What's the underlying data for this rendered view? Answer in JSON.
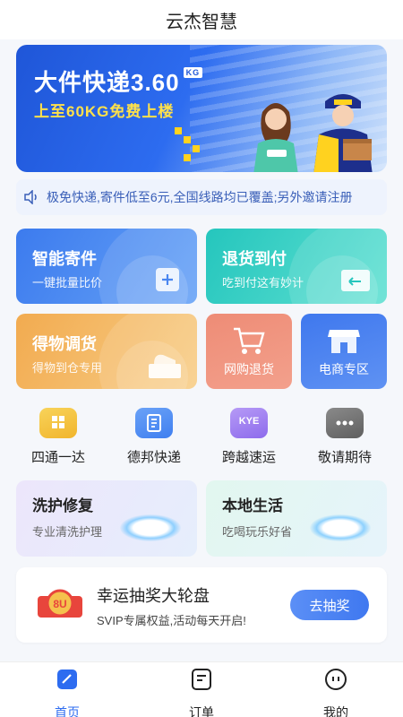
{
  "app": {
    "title": "云杰智慧"
  },
  "banner": {
    "headline": "大件快递3.60",
    "badge": "KG",
    "subline": "上至60KG免费上楼",
    "colors": {
      "primary": "#2d6cf0",
      "highlight": "#ffe14a"
    }
  },
  "notice": {
    "icon": "speaker-icon",
    "text": "极免快递,寄件低至6元,全国线路均已覆盖;另外邀请注册"
  },
  "feature_cards": [
    {
      "title": "智能寄件",
      "subtitle": "一键批量比价",
      "icon": "add-icon",
      "color": "#4a86f0"
    },
    {
      "title": "退货到付",
      "subtitle": "吃到付这有妙计",
      "icon": "return-box-icon",
      "color": "#33cfc4"
    },
    {
      "title": "得物调货",
      "subtitle": "得物到仓专用",
      "icon": "shoe-box-icon",
      "color": "#f4b45f"
    }
  ],
  "small_cards": [
    {
      "label": "网购退货",
      "icon": "shopping-cart-icon",
      "color": "#f0846f"
    },
    {
      "label": "电商专区",
      "icon": "storefront-icon",
      "color": "#4c83ef"
    }
  ],
  "carriers": [
    {
      "label": "四通一达",
      "icon": "grid-icon",
      "color": "#f5c742"
    },
    {
      "label": "德邦快递",
      "icon": "debang-logo-icon",
      "color": "#4f8df2"
    },
    {
      "label": "跨越速运",
      "icon": "kye-logo-icon",
      "badge": "KYE",
      "color": "#9d7bf0"
    },
    {
      "label": "敬请期待",
      "icon": "more-dots-icon",
      "color": "#777777"
    }
  ],
  "services": [
    {
      "title": "洗护修复",
      "subtitle": "专业清洗护理"
    },
    {
      "title": "本地生活",
      "subtitle": "吃喝玩乐好省"
    }
  ],
  "lucky_draw": {
    "title": "幸运抽奖大轮盘",
    "subtitle": "SVIP专属权益,活动每天开启!",
    "button": "去抽奖",
    "logo_text": "8U"
  },
  "tabbar": [
    {
      "label": "首页",
      "icon": "home-icon",
      "active": true
    },
    {
      "label": "订单",
      "icon": "order-icon",
      "active": false
    },
    {
      "label": "我的",
      "icon": "profile-icon",
      "active": false
    }
  ]
}
